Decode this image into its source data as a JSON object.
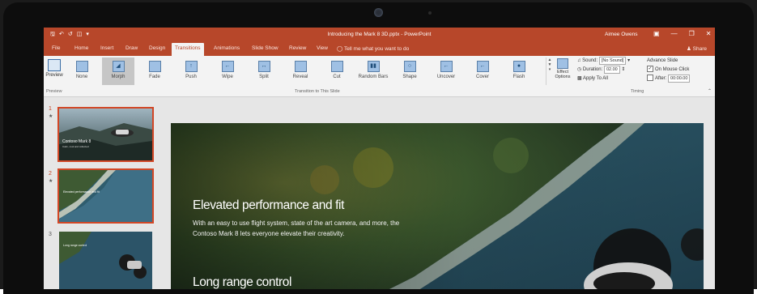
{
  "app": {
    "title": "Introducing the Mark 8 3D.pptx - PowerPoint",
    "user": "Aimee Owens",
    "tell_me": "Tell me what you want to do",
    "share": "Share"
  },
  "qat": [
    "save-icon",
    "undo-icon",
    "redo-icon",
    "present-icon",
    "customize-icon"
  ],
  "window_controls": [
    "ribbon-display-icon",
    "minimize-icon",
    "restore-icon",
    "close-icon"
  ],
  "tabs": [
    "File",
    "Home",
    "Insert",
    "Draw",
    "Design",
    "Transitions",
    "Animations",
    "Slide Show",
    "Review",
    "View"
  ],
  "active_tab": "Transitions",
  "ribbon": {
    "preview_label": "Preview",
    "preview_group": "Preview",
    "transitions": [
      "None",
      "Morph",
      "Fade",
      "Push",
      "Wipe",
      "Split",
      "Reveal",
      "Cut",
      "Random Bars",
      "Shape",
      "Uncover",
      "Cover",
      "Flash"
    ],
    "selected_transition": "Morph",
    "effect_options": "Effect Options",
    "transition_group": "Transition to This Slide",
    "sound_label": "Sound:",
    "sound_value": "[No Sound]",
    "duration_label": "Duration:",
    "duration_value": "02.00",
    "apply_all": "Apply To All",
    "advance_title": "Advance Slide",
    "on_mouse_click": "On Mouse Click",
    "on_mouse_click_checked": true,
    "after_label": "After:",
    "after_value": "00:00.00",
    "after_checked": false,
    "timing_group": "Timing"
  },
  "thumbnails": [
    {
      "number": "1",
      "title": "Contoso Mark 8",
      "subtitle": "Calm, cool and collected",
      "selected": true
    },
    {
      "number": "2",
      "title": "Elevated performance and fit",
      "selected": false
    },
    {
      "number": "3",
      "title": "Long range control",
      "selected": false
    }
  ],
  "slide": {
    "title": "Elevated performance and fit",
    "body": "With an easy to use flight system, state of the art camera, and more, the Contoso Mark 8 lets everyone elevate their creativity.",
    "next_title": "Long range control"
  },
  "colors": {
    "accent": "#b7472a",
    "selection": "#d24726"
  }
}
